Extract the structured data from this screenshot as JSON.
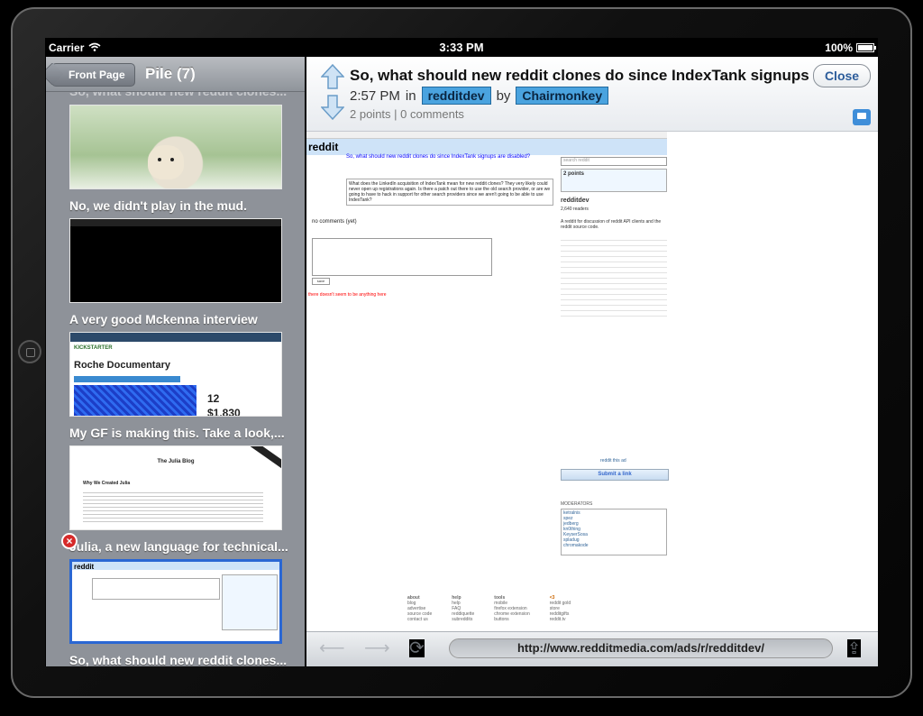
{
  "status": {
    "carrier": "Carrier",
    "time": "3:33 PM",
    "battery": "100%"
  },
  "left": {
    "back_label": "Front Page",
    "title": "Pile (7)",
    "peek_title": "So, what should new reddit clones...",
    "items": [
      {
        "title": "No, we didn't play in the mud."
      },
      {
        "title": "A very good Mckenna interview"
      },
      {
        "title": "My GF is making this.  Take a look,...",
        "thumb_heading": "Roche Documentary",
        "thumb_brand": "KICKSTARTER",
        "thumb_stat1": "12",
        "thumb_stat2": "$1,830"
      },
      {
        "title": "Julia, a new language for technical...",
        "thumb_heading": "The Julia Blog",
        "thumb_sub": "Why We Created Julia"
      },
      {
        "title": "So, what should new reddit clones..."
      }
    ]
  },
  "article": {
    "title": "So, what should new reddit clones do since IndexTank signups...",
    "time": "2:57 PM",
    "in_label": "in",
    "subreddit": "redditdev",
    "by_label": "by",
    "author": "Chairmonkey",
    "stats": "2 points | 0 comments",
    "close_label": "Close"
  },
  "web": {
    "logo": "reddit",
    "subreddit": "redditdev",
    "post_title": "So, what should new reddit clones do since IndexTank signups are disabled?",
    "post_body": "What does the LinkedIn acquisition of IndexTank mean for new reddit clones? They very likely could never open up registrations again. Is there a patch out there to use the old search provider, or are we going to have to hack in support for other search providers since we aren't going to be able to use IndexTank?",
    "no_comments": "no comments (yet)",
    "empty_msg": "there doesn't seem to be anything here",
    "save_label": "save",
    "search_placeholder": "search reddit",
    "points": "2 points",
    "readers": "2,640 readers",
    "sidebar_desc": "A reddit for discussion of reddit API clients and the reddit source code.",
    "submit_label": "Submit a link",
    "ad_label": "reddit this ad",
    "moderators_label": "MODERATORS",
    "moderators": [
      "ketralnis",
      "spez",
      "jedberg",
      "kn0thing",
      "KeyserSosa",
      "spladug",
      "chromakode"
    ],
    "footer": [
      {
        "h": "about",
        "items": [
          "blog",
          "advertise",
          "source code",
          "contact us"
        ]
      },
      {
        "h": "help",
        "items": [
          "help",
          "FAQ",
          "reddiquette",
          "subreddits"
        ]
      },
      {
        "h": "tools",
        "items": [
          "mobile",
          "firefox extension",
          "chrome extension",
          "buttons"
        ]
      },
      {
        "h": "<3",
        "items": [
          "reddit gold",
          "store",
          "redditgifts",
          "reddit.tv"
        ]
      }
    ]
  },
  "toolbar": {
    "url": "http://www.redditmedia.com/ads/r/redditdev/"
  }
}
